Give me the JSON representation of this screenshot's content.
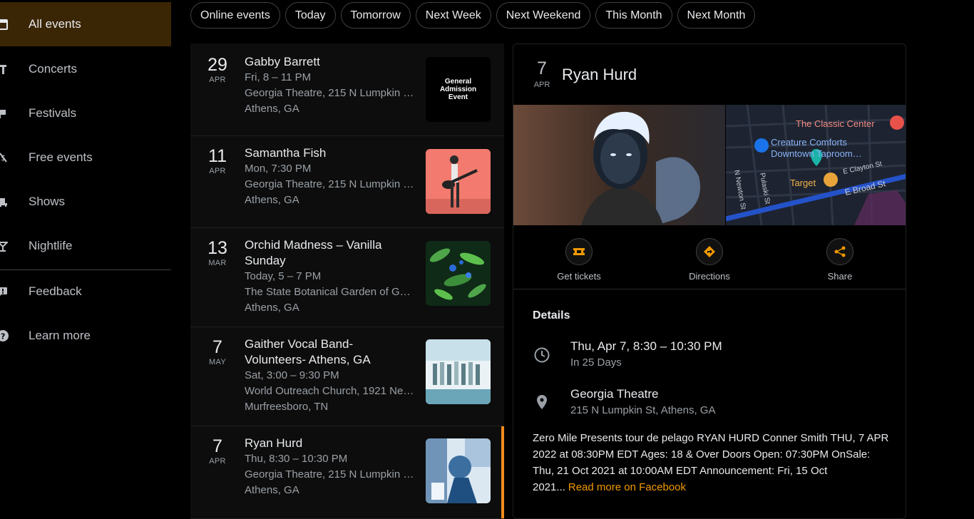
{
  "sidebar": {
    "items": [
      {
        "label": "All events",
        "icon": "calendar-icon"
      },
      {
        "label": "Concerts",
        "icon": "guitar-icon"
      },
      {
        "label": "Festivals",
        "icon": "flag-icon"
      },
      {
        "label": "Free events",
        "icon": "free-icon"
      },
      {
        "label": "Shows",
        "icon": "theater-seat-icon"
      },
      {
        "label": "Nightlife",
        "icon": "cocktail-icon"
      },
      {
        "label": "Feedback",
        "icon": "feedback-icon"
      },
      {
        "label": "Learn more",
        "icon": "help-icon"
      }
    ]
  },
  "chips": [
    "Online events",
    "Today",
    "Tomorrow",
    "Next Week",
    "Next Weekend",
    "This Month",
    "Next Month"
  ],
  "events": [
    {
      "day": "29",
      "month": "APR",
      "title": "Gabby Barrett",
      "time": "Fri, 8 – 11 PM",
      "venue": "Georgia Theatre, 215 N Lumpkin …",
      "city": "Athens, GA",
      "thumb_text": "General Admission Event"
    },
    {
      "day": "11",
      "month": "APR",
      "title": "Samantha Fish",
      "time": "Mon, 7:30 PM",
      "venue": "Georgia Theatre, 215 N Lumpkin …",
      "city": "Athens, GA"
    },
    {
      "day": "13",
      "month": "MAR",
      "title": "Orchid Madness – Vanilla Sunday",
      "time": "Today, 5 – 7 PM",
      "venue": "The State Botanical Garden of G…",
      "city": "Athens, GA"
    },
    {
      "day": "7",
      "month": "MAY",
      "title": "Gaither Vocal Band- Volunteers- Athens, GA",
      "time": "Sat, 3:00 – 9:30 PM",
      "venue": "World Outreach Church, 1921 Ne…",
      "city": "Murfreesboro, TN"
    },
    {
      "day": "7",
      "month": "APR",
      "title": "Ryan Hurd",
      "time": "Thu, 8:30 – 10:30 PM",
      "venue": "Georgia Theatre, 215 N Lumpkin …",
      "city": "Athens, GA"
    }
  ],
  "detail": {
    "day": "7",
    "month": "APR",
    "title": "Ryan Hurd",
    "map_labels": {
      "classic_center": "The Classic Center",
      "creature_comforts_1": "Creature Comforts",
      "creature_comforts_2": "Downtown Taproom…",
      "target": "Target",
      "e_clayton": "E Clayton St",
      "e_broad": "E Broad St",
      "n_newton": "N Newton St",
      "pulaski": "Pulaski St"
    },
    "actions": {
      "tickets": "Get tickets",
      "directions": "Directions",
      "share": "Share"
    },
    "details_heading": "Details",
    "datetime": "Thu, Apr 7, 8:30 – 10:30 PM",
    "relative": "In 25 Days",
    "venue_name": "Georgia Theatre",
    "venue_address": "215 N Lumpkin St, Athens, GA",
    "description": "Zero Mile Presents tour de pelago RYAN HURD Conner Smith THU, 7 APR 2022 at 08:30PM EDT Ages: 18 & Over Doors Open: 07:30PM OnSale: Thu, 21 Oct 2021 at 10:00AM EDT Announcement: Fri, 15 Oct 2021...",
    "read_more": "Read more on Facebook"
  },
  "colors": {
    "accent": "#f28b1d",
    "active_bg": "#3a2505",
    "link": "#f29900"
  }
}
